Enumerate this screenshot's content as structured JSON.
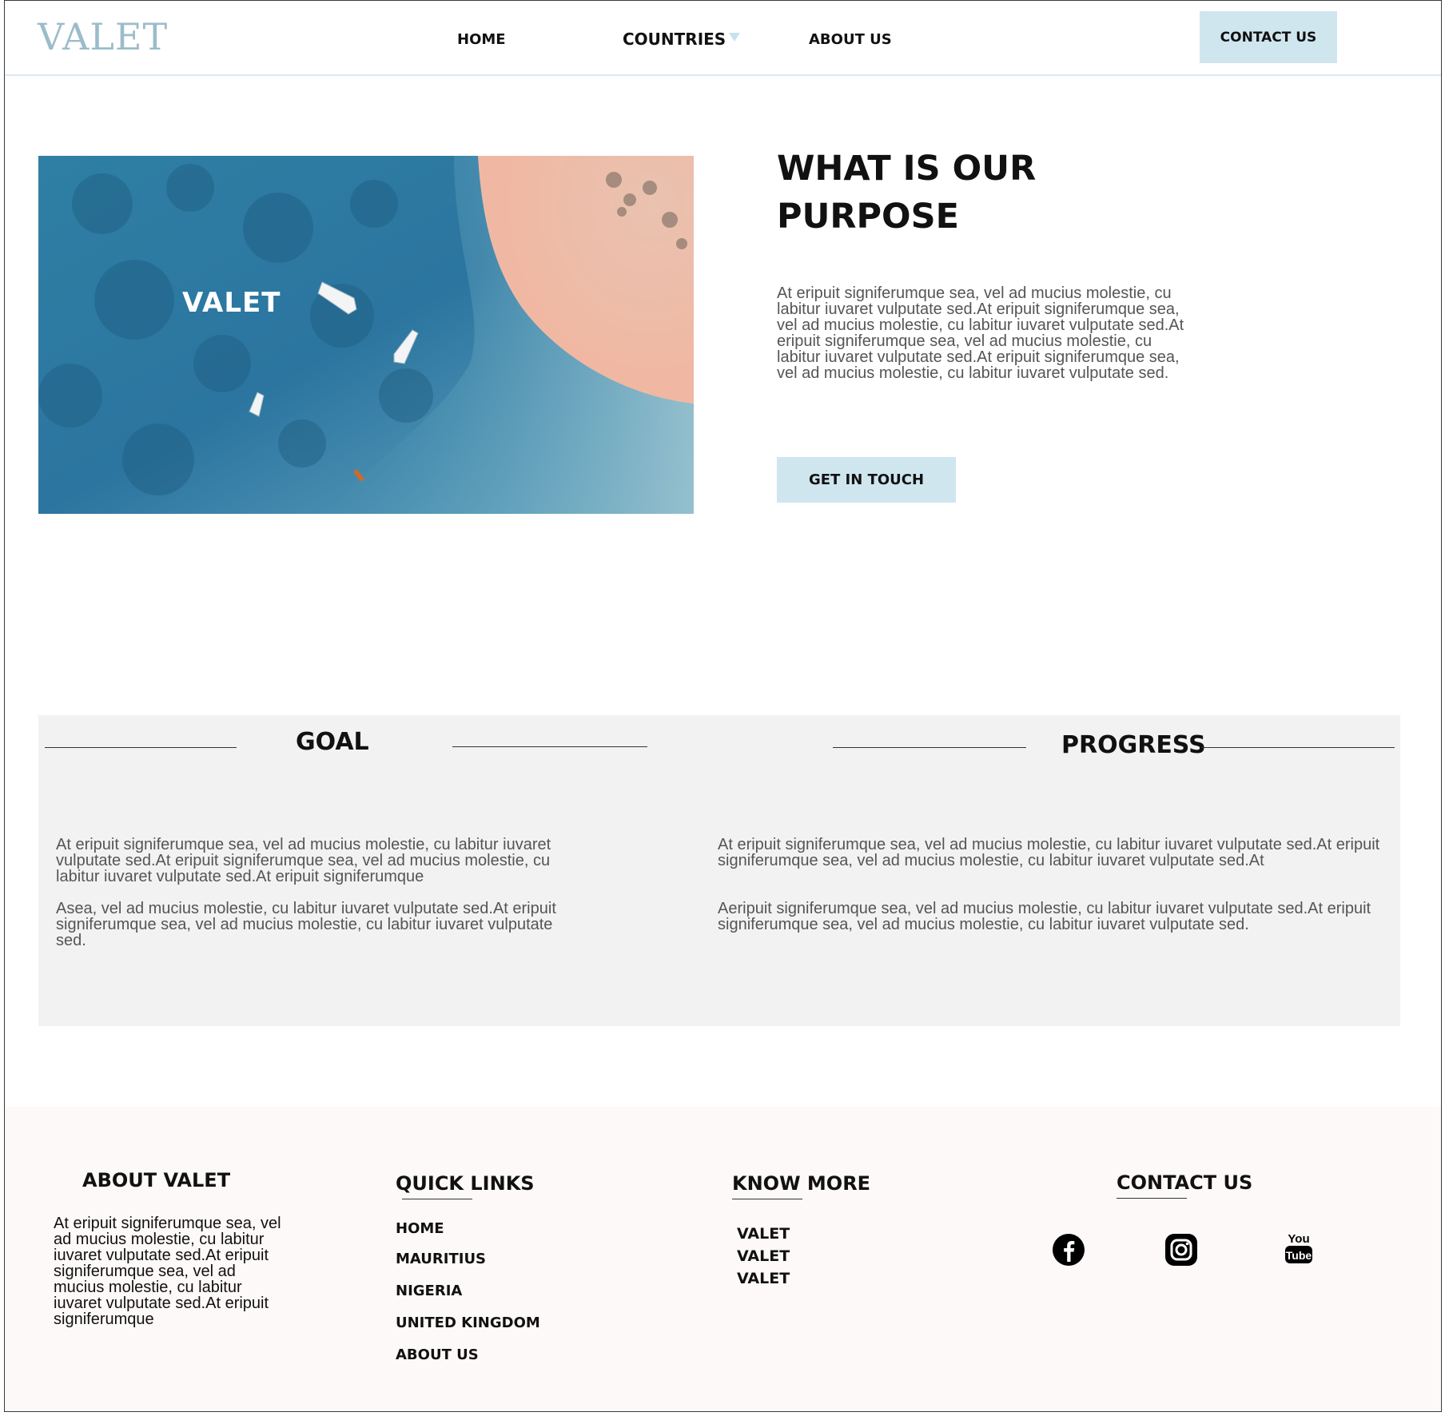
{
  "header": {
    "logo": "VALET",
    "nav": {
      "home": "HOME",
      "countries": "COUNTRIES",
      "about": "ABOUT US"
    },
    "contact_button": "CONTACT US"
  },
  "hero": {
    "image_label": "VALET",
    "title_line1": "WHAT IS OUR",
    "title_line2": "PURPOSE",
    "body": "At eripuit signiferumque sea, vel ad mucius molestie, cu labitur iuvaret vulputate sed.At eripuit signiferumque sea, vel ad mucius molestie, cu labitur iuvaret vulputate sed.At eripuit signiferumque sea, vel ad mucius molestie, cu labitur iuvaret vulputate sed.At eripuit signiferumque sea, vel ad mucius molestie, cu labitur iuvaret vulputate sed.",
    "cta": "GET IN TOUCH"
  },
  "goal": {
    "title": "GOAL",
    "p1": "At eripuit signiferumque sea, vel ad mucius molestie, cu labitur iuvaret vulputate sed.At eripuit signiferumque sea, vel ad mucius molestie, cu labitur iuvaret vulputate sed.At eripuit signiferumque",
    "p2": " Asea, vel ad mucius molestie, cu labitur iuvaret vulputate sed.At eripuit signiferumque sea, vel ad mucius molestie, cu labitur iuvaret vulputate sed."
  },
  "progress": {
    "title": "PROGRESS",
    "p1": "At eripuit signiferumque sea, vel ad mucius molestie, cu labitur iuvaret vulputate sed.At eripuit signiferumque sea, vel ad mucius molestie, cu labitur iuvaret vulputate sed.At",
    "p2": "Aeripuit signiferumque sea, vel ad mucius molestie, cu labitur iuvaret vulputate sed.At eripuit signiferumque sea, vel ad mucius molestie, cu labitur iuvaret vulputate sed."
  },
  "footer": {
    "about": {
      "title": "ABOUT VALET",
      "text": "At eripuit signiferumque sea, vel ad mucius molestie, cu labitur iuvaret vulputate sed.At eripuit signiferumque sea, vel ad mucius molestie, cu labitur iuvaret vulputate sed.At eripuit signiferumque"
    },
    "quick_links": {
      "title": "QUICK LINKS",
      "items": [
        "HOME",
        "MAURITIUS",
        "NIGERIA",
        "UNITED KINGDOM",
        "ABOUT US"
      ]
    },
    "know_more": {
      "title": "KNOW MORE",
      "items": [
        "VALET",
        "VALET",
        "VALET"
      ]
    },
    "contact": {
      "title": "CONTACT US",
      "social_icons": [
        "facebook-icon",
        "instagram-icon",
        "youtube-icon"
      ],
      "youtube_you": "You",
      "youtube_tube": "Tube"
    }
  },
  "colors": {
    "accent_light_blue": "#cfe6ef",
    "logo_color": "#9bbcca",
    "band_background": "#f2f2f2",
    "footer_background": "#fdf9f8"
  }
}
